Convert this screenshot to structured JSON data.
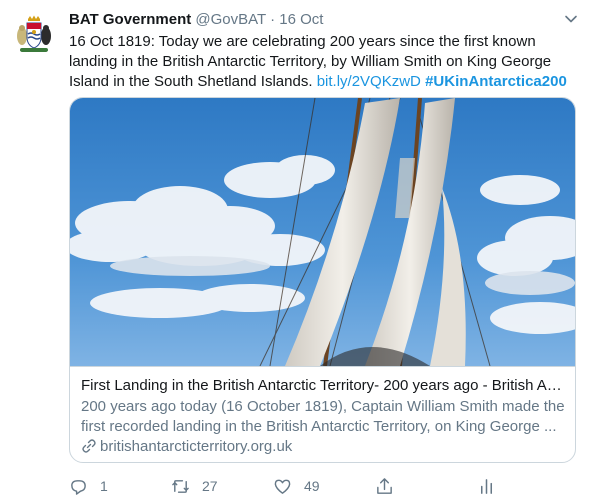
{
  "tweet": {
    "author_name": "BAT Government",
    "handle": "@GovBAT",
    "separator": "·",
    "date": "16 Oct",
    "text_main": "16 Oct 1819: Today we are celebrating 200 years since the first known landing in the British Antarctic Territory, by William Smith on King George Island in the South Shetland Islands.",
    "link_text": "bit.ly/2VQKzwD",
    "hashtag": "#UKinAntarctica200"
  },
  "card": {
    "title": "First Landing in the British Antarctic Territory- 200 years ago - British An...",
    "description": "200 years ago today (16 October 1819), Captain William Smith made the first recorded landing in the British Antarctic Territory, on King George ...",
    "domain": "britishantarcticterritory.org.uk"
  },
  "actions": {
    "reply_count": "1",
    "retweet_count": "27",
    "like_count": "49"
  },
  "colors": {
    "link": "#1b95e0",
    "secondary_text": "#657786",
    "border": "#ccd6dd"
  },
  "icons": [
    "avatar-crest",
    "chevron-down-icon",
    "link-icon",
    "reply-icon",
    "retweet-icon",
    "like-icon",
    "share-icon",
    "analytics-icon"
  ]
}
